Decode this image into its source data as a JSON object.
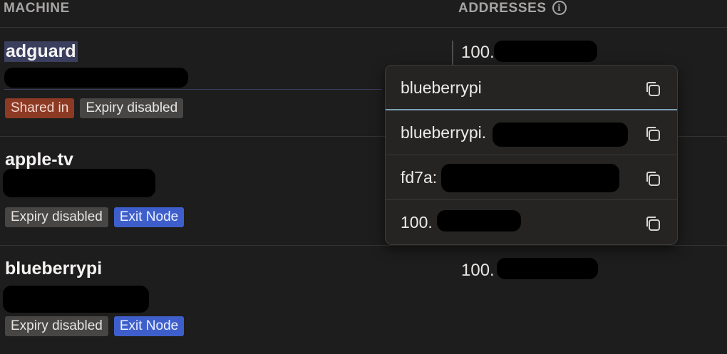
{
  "table": {
    "columns": {
      "machine": "MACHINE",
      "addresses": "ADDRESSES"
    }
  },
  "rows": [
    {
      "name": "adguard",
      "badges": [
        {
          "label": "Shared in",
          "color": "red"
        },
        {
          "label": "Expiry disabled",
          "color": "gray"
        }
      ],
      "address": "100."
    },
    {
      "name": "apple-tv",
      "badges": [
        {
          "label": "Expiry disabled",
          "color": "gray"
        },
        {
          "label": "Exit Node",
          "color": "blue"
        }
      ],
      "address": ""
    },
    {
      "name": "blueberrypi",
      "badges": [
        {
          "label": "Expiry disabled",
          "color": "gray"
        },
        {
          "label": "Exit Node",
          "color": "blue"
        }
      ],
      "address": "100."
    }
  ],
  "popover": {
    "items": [
      {
        "label": "blueberrypi"
      },
      {
        "label": "blueberrypi."
      },
      {
        "label": "fd7a:"
      },
      {
        "label": "100."
      }
    ]
  },
  "icons": {
    "info": "info-icon",
    "copy": "copy-icon"
  },
  "colors": {
    "shared_in": "#8d3a25",
    "exit_node": "#3e5fcb",
    "expiry": "#474645",
    "background": "#1e1d1d"
  }
}
